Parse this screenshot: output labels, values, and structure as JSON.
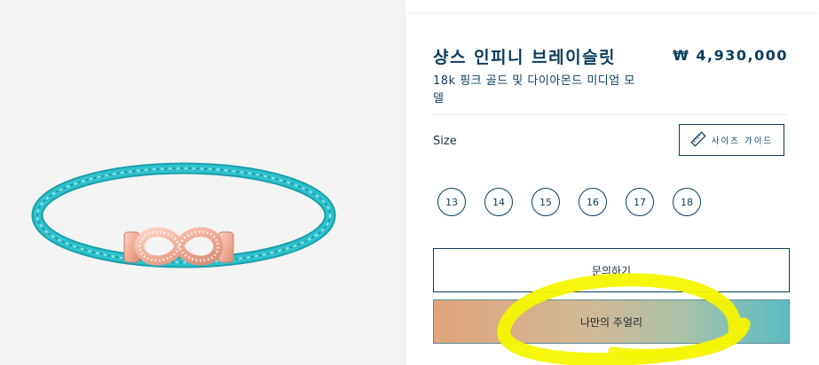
{
  "product": {
    "title": "샹스 인피니 브레이슬릿",
    "price": "₩ 4,930,000",
    "subtitle": "18k 핑크 골드 및 다이아몬드 미디엄 모델",
    "image_alt": "teal cable bracelet with rose gold diamond buckle"
  },
  "size": {
    "label": "Size",
    "guide_button_label": "사이즈 가이드",
    "guide_icon": "ruler-icon",
    "options": [
      "13",
      "14",
      "15",
      "16",
      "17",
      "18"
    ]
  },
  "actions": {
    "inquiry_label": "문의하기",
    "my_jewelry_label": "나만의 주얼리"
  },
  "colors": {
    "navy": "#0b3d5c",
    "cable_teal": "#22b3bf",
    "rose_gold": "#f2b7a2",
    "highlight_marker": "#f5f500"
  }
}
